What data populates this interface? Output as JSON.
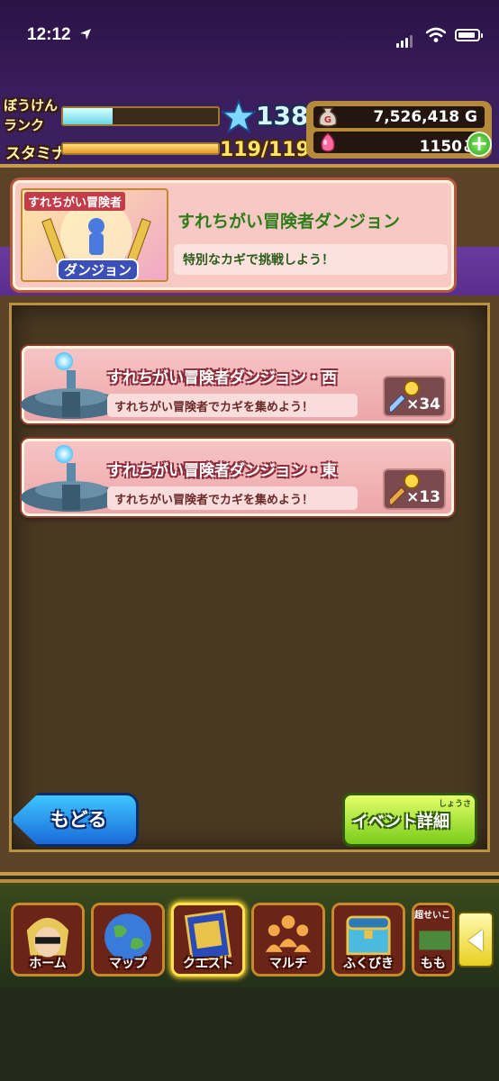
{
  "status_bar": {
    "time": "12:12"
  },
  "player": {
    "rank_label": "ぼうけん\nランク",
    "stamina_label": "スタミナ",
    "rank": "138",
    "rank_progress": 0.32,
    "stamina": "119/119",
    "stamina_progress": 1.0,
    "gold": "7,526,418",
    "gold_unit": "G",
    "gems": "1150",
    "gems_unit": "こ"
  },
  "banner": {
    "art_tag": "すれちがい冒険者",
    "art_caption": "ダンジョン",
    "title": "すれちがい冒険者ダンジョン",
    "subtitle": "特別なカギで挑戦しよう！"
  },
  "quests": [
    {
      "title": "すれちがい冒険者ダンジョン・西",
      "subtitle": "すれちがい冒険者でカギを集めよう！",
      "key_count": "×34"
    },
    {
      "title": "すれちがい冒険者ダンジョン・東",
      "subtitle": "すれちがい冒険者でカギを集めよう！",
      "key_count": "×13"
    }
  ],
  "buttons": {
    "back": "もどる",
    "detail": "イベント詳細",
    "detail_ruby": "しょうさい"
  },
  "nav": {
    "items": [
      {
        "label": "ホーム",
        "icon": "hero-portrait-icon"
      },
      {
        "label": "マップ",
        "icon": "globe-icon"
      },
      {
        "label": "クエスト",
        "icon": "quest-book-icon"
      },
      {
        "label": "マルチ",
        "icon": "party-icon"
      },
      {
        "label": "ふくびき",
        "icon": "treasure-chest-icon"
      },
      {
        "label": "もも",
        "icon": "cart-icon",
        "badge": "超せいこ"
      }
    ],
    "active_index": 2
  },
  "colors": {
    "header_purple": "#3a1d5c",
    "board_brown": "#5a4326",
    "card_pink": "#f6c4c4",
    "banner_title_green": "#2e7d1a",
    "back_blue": "#1a6ad8",
    "detail_green": "#7acc1a"
  }
}
